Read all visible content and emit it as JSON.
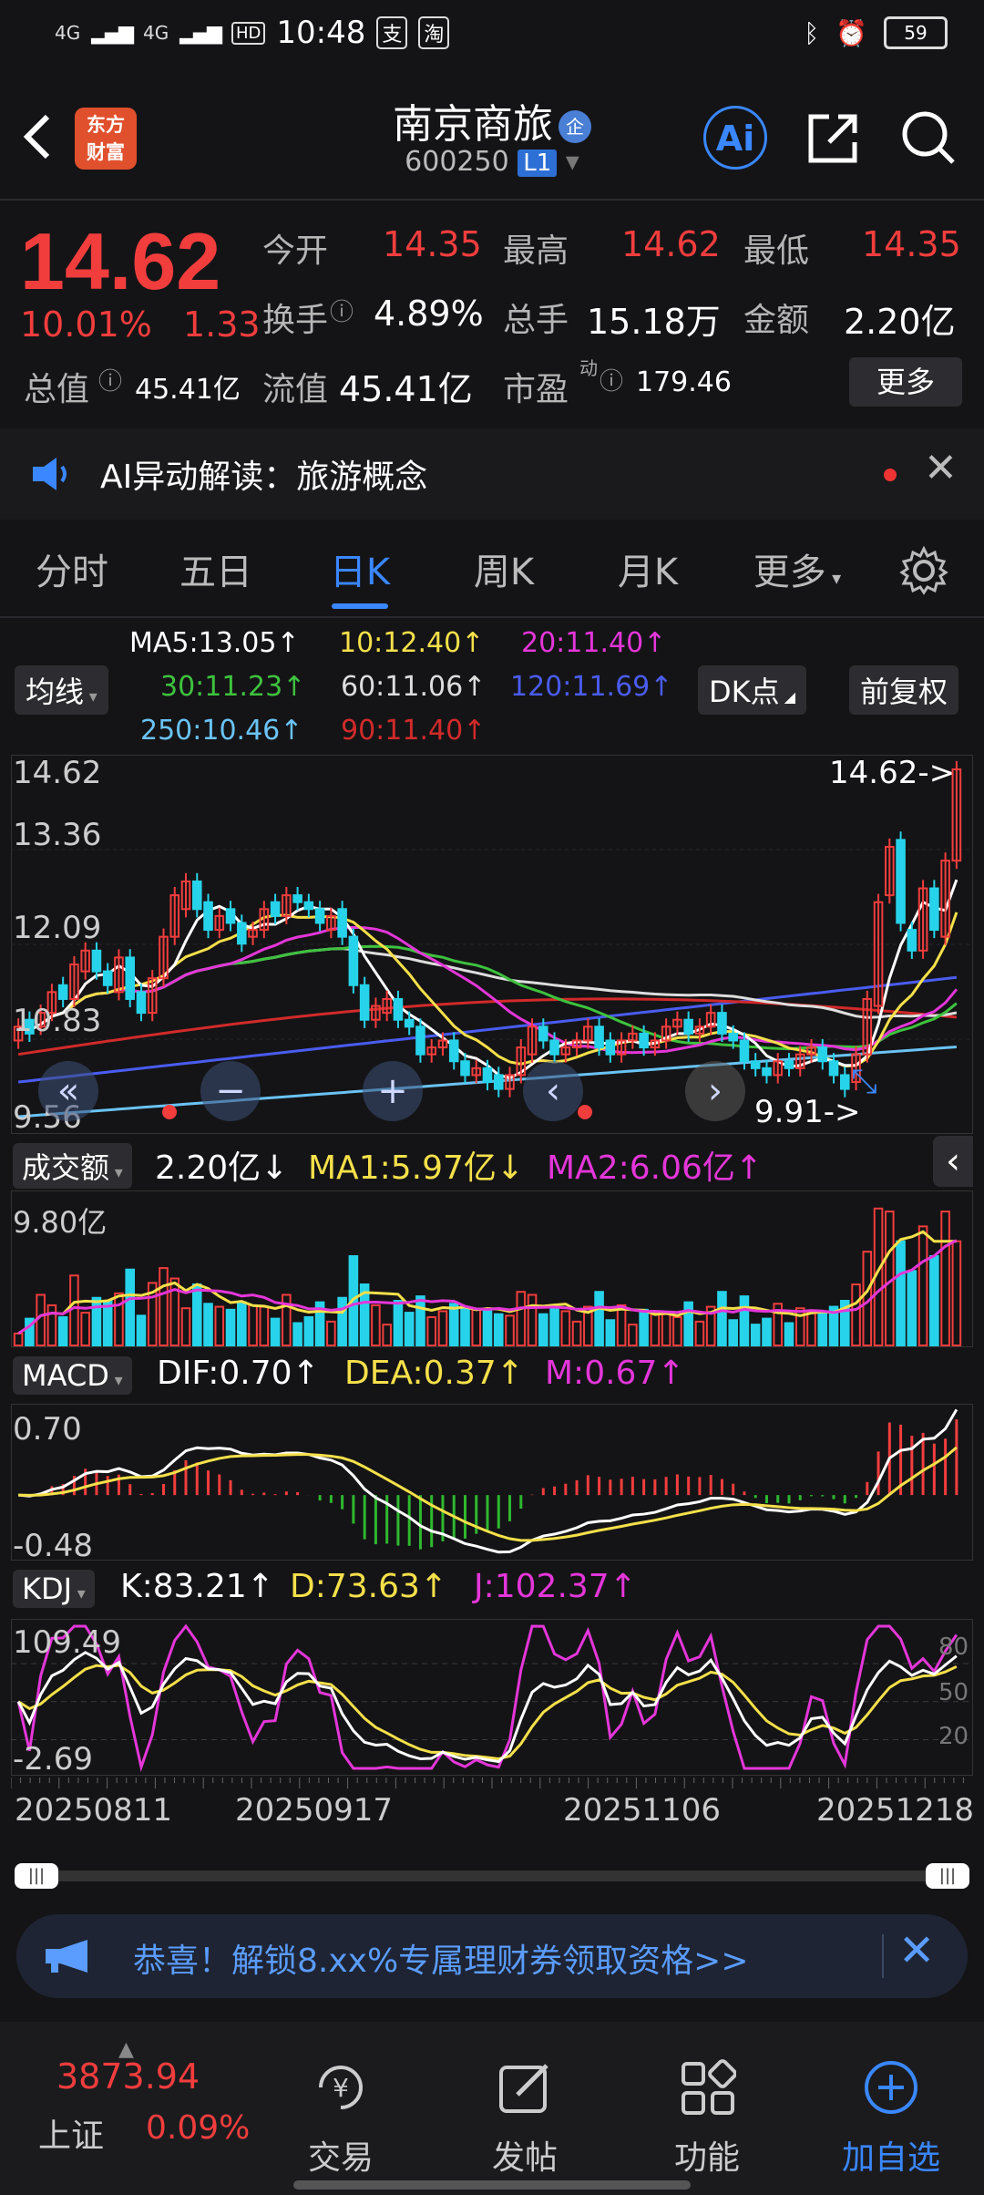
{
  "status_bar": {
    "network1": "4G",
    "network2": "4G",
    "hd": "HD",
    "time": "10:48",
    "battery": "59"
  },
  "header": {
    "stock_name": "南京商旅",
    "badge": "企",
    "stock_code": "600250",
    "level": "L1",
    "logo_text_line1": "东方",
    "logo_text_line2": "财富",
    "ai_label": "Ai"
  },
  "quote": {
    "price": "14.62",
    "change_pct": "10.01%",
    "change_amt": "1.33",
    "open_label": "今开",
    "open": "14.35",
    "high_label": "最高",
    "high": "14.62",
    "low_label": "最低",
    "low": "14.35",
    "turnover_label": "换手",
    "turnover": "4.89%",
    "volume_label": "总手",
    "volume": "15.18万",
    "amount_label": "金额",
    "amount": "2.20亿",
    "mktcap_label": "总值",
    "mktcap": "45.41亿",
    "float_label": "流值",
    "float_cap": "45.41亿",
    "pe_label": "市盈",
    "pe_sup": "动",
    "pe": "179.46",
    "more_btn": "更多"
  },
  "ai_bar": {
    "text": "AI异动解读：旅游概念"
  },
  "tabs": [
    "分时",
    "五日",
    "日K",
    "周K",
    "月K",
    "更多"
  ],
  "active_tab": 2,
  "ma_legend": {
    "junxian": "均线",
    "ma5": "MA5:13.05↑",
    "ma10": "10:12.40↑",
    "ma20": "20:11.40↑",
    "ma30": "30:11.23↑",
    "ma60": "60:11.06↑",
    "ma120": "120:11.69↑",
    "ma250": "250:10.46↑",
    "ma90": "90:11.40↑",
    "dk_btn": "DK点",
    "fq_btn": "前复权"
  },
  "kline": {
    "y_labels": [
      "14.62",
      "13.36",
      "12.09",
      "10.83",
      "9.56"
    ],
    "max_label": "14.62->",
    "min_label": "9.91->"
  },
  "volume_panel": {
    "label": "成交额",
    "value": "2.20亿↓",
    "ma1": "MA1:5.97亿↓",
    "ma2": "MA2:6.06亿↑",
    "y_label": "9.80亿"
  },
  "macd_panel": {
    "label": "MACD",
    "dif": "DIF:0.70↑",
    "dea": "DEA:0.37↑",
    "m": "M:0.67↑",
    "y_top": "0.70",
    "y_bottom": "-0.48"
  },
  "kdj_panel": {
    "label": "KDJ",
    "k": "K:83.21↑",
    "d": "D:73.63↑",
    "j": "J:102.37↑",
    "y_top": "109.49",
    "y_bottom": "-2.69",
    "r80": "80",
    "r50": "50",
    "r20": "20"
  },
  "dates": [
    "20250811",
    "20250917",
    "20251106",
    "20251218"
  ],
  "promo": {
    "text": "恭喜！解锁8.xx%专属理财券领取资格>>"
  },
  "bottom_nav": {
    "index_value": "3873.94",
    "index_name": "上证",
    "index_change": "0.09%",
    "items": [
      "交易",
      "发帖",
      "功能",
      "加自选"
    ]
  },
  "colors": {
    "up": "#f23d3d",
    "down": "#27d3ea",
    "accent": "#3a87ff",
    "ma5": "#ffffff",
    "ma10": "#f5e04a",
    "ma20": "#e436d9",
    "ma30": "#3ec23e",
    "ma60": "#dddddd",
    "ma120": "#4a5cf0",
    "ma250": "#6ac3f5",
    "ma90": "#d22a2a"
  },
  "chart_data": {
    "type": "candlestick",
    "title": "",
    "y_range": [
      9.56,
      14.62
    ],
    "closes": [
      10.9,
      10.8,
      11.1,
      11.4,
      11.3,
      11.8,
      12.0,
      11.7,
      11.5,
      11.9,
      11.3,
      11.1,
      11.6,
      12.2,
      12.8,
      13.0,
      12.6,
      12.3,
      12.5,
      12.4,
      12.1,
      12.3,
      12.6,
      12.5,
      12.8,
      12.7,
      12.6,
      12.4,
      12.5,
      12.2,
      11.5,
      11.0,
      11.2,
      11.3,
      11.0,
      10.9,
      10.5,
      10.6,
      10.7,
      10.4,
      10.2,
      10.3,
      10.1,
      10.0,
      10.2,
      10.6,
      10.9,
      10.7,
      10.5,
      10.6,
      10.7,
      10.9,
      10.6,
      10.5,
      10.7,
      10.8,
      10.6,
      10.7,
      10.9,
      11.0,
      10.8,
      10.9,
      11.1,
      10.8,
      10.7,
      10.4,
      10.3,
      10.2,
      10.4,
      10.3,
      10.5,
      10.6,
      10.4,
      10.2,
      10.0,
      10.5,
      11.3,
      12.7,
      13.5,
      12.4,
      12.0,
      12.9,
      12.3,
      13.3,
      14.62
    ],
    "opens": [
      10.7,
      11.0,
      10.9,
      11.1,
      11.5,
      11.3,
      11.7,
      12.0,
      11.7,
      11.4,
      11.9,
      11.4,
      11.1,
      11.6,
      12.2,
      12.6,
      13.0,
      12.7,
      12.3,
      12.6,
      12.4,
      12.2,
      12.3,
      12.7,
      12.5,
      12.8,
      12.7,
      12.6,
      12.3,
      12.6,
      12.2,
      11.5,
      11.0,
      11.1,
      11.3,
      11.0,
      10.9,
      10.5,
      10.6,
      10.7,
      10.4,
      10.2,
      10.3,
      10.2,
      10.0,
      10.2,
      10.5,
      10.9,
      10.7,
      10.5,
      10.6,
      10.7,
      10.9,
      10.7,
      10.5,
      10.7,
      10.8,
      10.6,
      10.7,
      10.9,
      11.0,
      10.8,
      10.9,
      11.1,
      10.8,
      10.7,
      10.4,
      10.3,
      10.2,
      10.4,
      10.3,
      10.5,
      10.6,
      10.4,
      10.2,
      10.1,
      10.5,
      11.2,
      12.8,
      13.6,
      12.3,
      12.0,
      12.9,
      12.2,
      13.3
    ],
    "volume_unit": "亿",
    "volume_top": 9.8,
    "macd_range": [
      -0.48,
      0.7
    ],
    "kdj_range": [
      -2.69,
      109.49
    ],
    "x_tick_labels": [
      "20250811",
      "20250917",
      "20251106",
      "20251218"
    ]
  }
}
